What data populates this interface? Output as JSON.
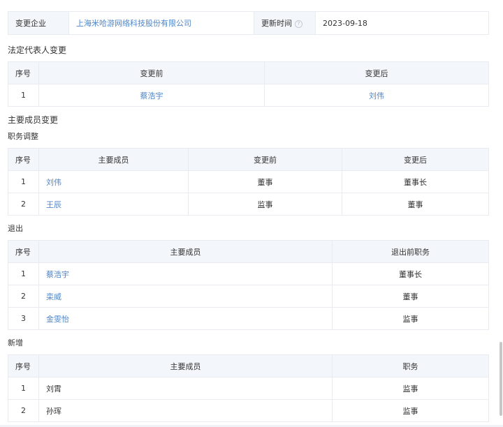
{
  "info": {
    "company_label": "变更企业",
    "company_value": "上海米哈游网络科技股份有限公司",
    "update_label": "更新时间",
    "update_value": "2023-09-18"
  },
  "legal_rep": {
    "title": "法定代表人变更",
    "headers": [
      "序号",
      "变更前",
      "变更后"
    ],
    "rows": [
      [
        "1",
        "蔡浩宇",
        "刘伟"
      ]
    ]
  },
  "members": {
    "title": "主要成员变更",
    "adjust": {
      "title": "职务调整",
      "headers": [
        "序号",
        "主要成员",
        "变更前",
        "变更后"
      ],
      "rows": [
        [
          "1",
          "刘伟",
          "董事",
          "董事长"
        ],
        [
          "2",
          "王辰",
          "监事",
          "董事"
        ]
      ]
    },
    "exit": {
      "title": "退出",
      "headers": [
        "序号",
        "主要成员",
        "退出前职务"
      ],
      "rows": [
        [
          "1",
          "蔡浩宇",
          "董事长"
        ],
        [
          "2",
          "栾威",
          "董事"
        ],
        [
          "3",
          "金雯怡",
          "监事"
        ]
      ]
    },
    "add": {
      "title": "新增",
      "headers": [
        "序号",
        "主要成员",
        "职务"
      ],
      "rows": [
        [
          "1",
          "刘霄",
          "监事"
        ],
        [
          "2",
          "孙珲",
          "监事"
        ]
      ]
    }
  },
  "icons": {
    "help": "help-circle-icon"
  }
}
